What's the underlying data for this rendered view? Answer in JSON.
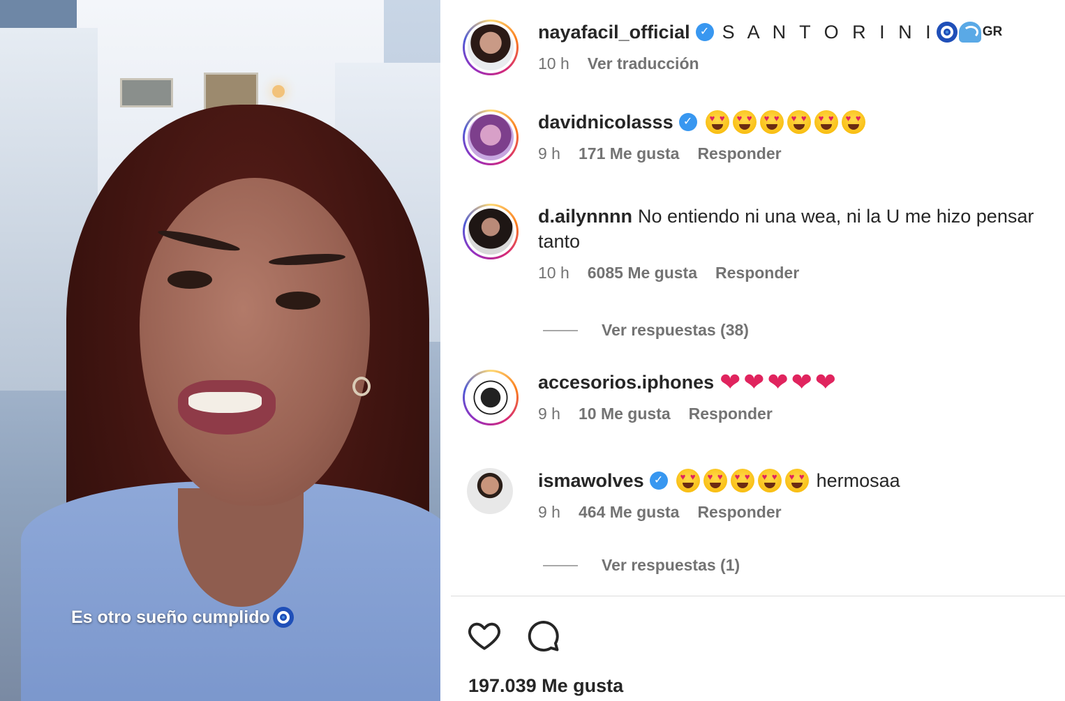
{
  "video": {
    "caption": "Es otro sueño cumplido",
    "caption_emoji": "nazar-eye-emoji"
  },
  "post": {
    "username": "nayafacil_official",
    "verified": true,
    "location_text": "S A N T O R I N I",
    "flag_text": "GR",
    "time": "10 h",
    "translate_label": "Ver traducción"
  },
  "comments": [
    {
      "username": "davidnicolasss",
      "verified": true,
      "emoji": [
        "heart-eyes",
        "heart-eyes",
        "heart-eyes",
        "heart-eyes",
        "heart-eyes",
        "heart-eyes"
      ],
      "time": "9 h",
      "likes": "171 Me gusta",
      "reply": "Responder"
    },
    {
      "username": "d.ailynnnn",
      "verified": false,
      "text": "No entiendo ni una wea, ni la U me hizo pensar tanto",
      "time": "10 h",
      "likes": "6085 Me gusta",
      "reply": "Responder",
      "view_replies": "Ver respuestas (38)"
    },
    {
      "username": "accesorios.iphones",
      "verified": false,
      "emoji": [
        "red-heart",
        "red-heart",
        "red-heart",
        "red-heart",
        "red-heart"
      ],
      "time": "9 h",
      "likes": "10 Me gusta",
      "reply": "Responder"
    },
    {
      "username": "ismawolves",
      "verified": true,
      "emoji": [
        "heart-eyes",
        "heart-eyes",
        "heart-eyes",
        "heart-eyes",
        "heart-eyes"
      ],
      "text": "hermosaa",
      "time": "9 h",
      "likes": "464 Me gusta",
      "reply": "Responder",
      "view_replies": "Ver respuestas (1)"
    }
  ],
  "footer": {
    "like_icon": "heart-outline-icon",
    "comment_icon": "speech-bubble-icon",
    "total_likes": "197.039 Me gusta"
  },
  "colors": {
    "verified_blue": "#3897f0",
    "meta_gray": "#737373",
    "text": "#262626",
    "heart_red": "#e0245e"
  }
}
